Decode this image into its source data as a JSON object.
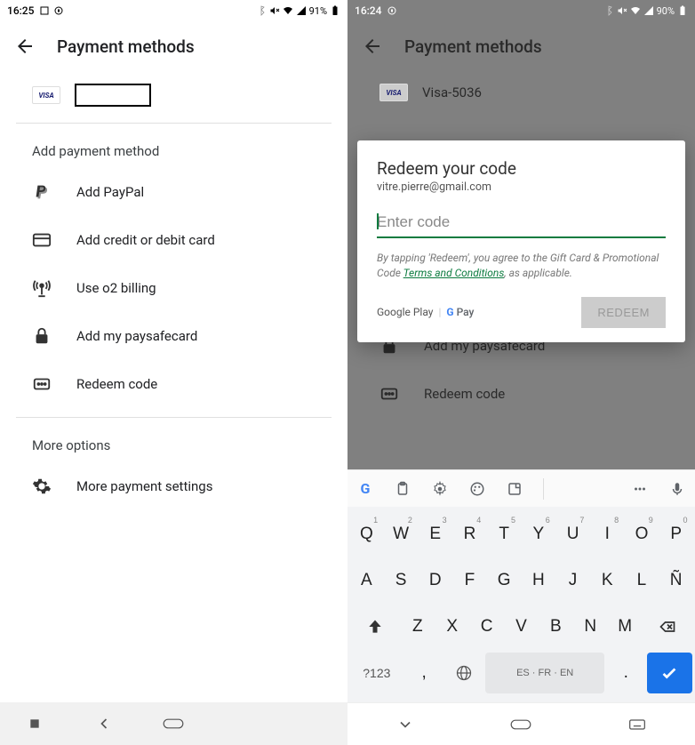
{
  "left": {
    "status": {
      "time": "16:25",
      "battery": "91%"
    },
    "header": {
      "title": "Payment methods"
    },
    "visa_label": "VISA",
    "add_section": "Add payment method",
    "items": [
      {
        "label": "Add PayPal"
      },
      {
        "label": "Add credit or debit card"
      },
      {
        "label": "Use o2 billing"
      },
      {
        "label": "Add my paysafecard"
      },
      {
        "label": "Redeem code"
      }
    ],
    "more_section": "More options",
    "more_item": "More payment settings"
  },
  "right": {
    "status": {
      "time": "16:24",
      "battery": "90%"
    },
    "header": {
      "title": "Payment methods"
    },
    "visa_label": "VISA",
    "card_label": "Visa-5036",
    "bg_items": [
      {
        "label": "Add my paysafecard"
      },
      {
        "label": "Redeem code"
      }
    ],
    "dialog": {
      "title": "Redeem your code",
      "email": "vitre.pierre@gmail.com",
      "placeholder": "Enter code",
      "terms_pre": "By tapping 'Redeem', you agree to the Gift Card & Promotional Code ",
      "terms_link": "Terms and Conditions",
      "terms_post": ", as applicable.",
      "play": "Google Play",
      "gpay": "G Pay",
      "redeem": "REDEEM"
    },
    "keyboard": {
      "row1": [
        "Q",
        "W",
        "E",
        "R",
        "T",
        "Y",
        "U",
        "I",
        "O",
        "P"
      ],
      "row1_sup": [
        "1",
        "2",
        "3",
        "4",
        "5",
        "6",
        "7",
        "8",
        "9",
        "0"
      ],
      "row2": [
        "A",
        "S",
        "D",
        "F",
        "G",
        "H",
        "J",
        "K",
        "L",
        "Ñ"
      ],
      "row3": [
        "Z",
        "X",
        "C",
        "V",
        "B",
        "N",
        "M"
      ],
      "sym": "?123",
      "comma": ",",
      "space": "ES · FR · EN",
      "dot": "."
    }
  }
}
